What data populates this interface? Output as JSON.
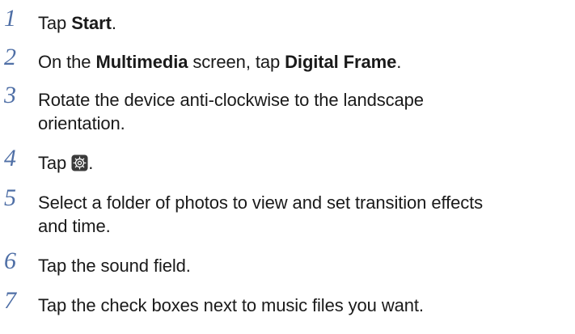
{
  "steps": [
    {
      "number": "1",
      "t1": "Tap ",
      "b1": "Start",
      "t2": "."
    },
    {
      "number": "2",
      "t1": "On the ",
      "b1": "Multimedia",
      "t2": " screen, tap ",
      "b2": "Digital Frame",
      "t3": "."
    },
    {
      "number": "3",
      "line1": "Rotate the device anti-clockwise to the landscape",
      "line2": "orientation."
    },
    {
      "number": "4",
      "t1": "Tap ",
      "icon": "settings-gear-icon",
      "t2": "."
    },
    {
      "number": "5",
      "line1": "Select a folder of photos to view and set transition effects",
      "line2": "and time."
    },
    {
      "number": "6",
      "text": "Tap the sound field."
    },
    {
      "number": "7",
      "text": "Tap the check boxes next to music files you want."
    }
  ],
  "colors": {
    "step_number": "#4f6fa6",
    "text": "#1a1a1a"
  }
}
